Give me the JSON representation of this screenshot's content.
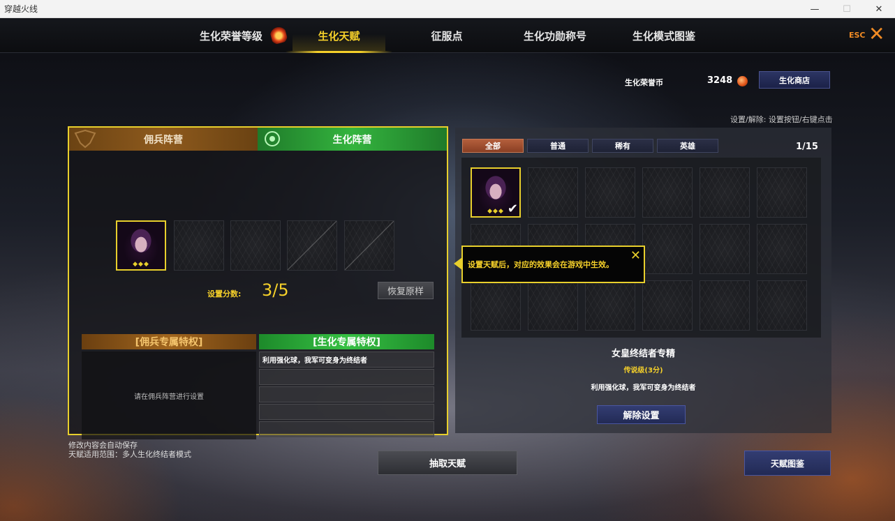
{
  "window": {
    "title": "穿越火线",
    "minimize": "—",
    "maximize": "☐",
    "close": "✕"
  },
  "nav": {
    "tabs": [
      {
        "label": "生化荣誉等级"
      },
      {
        "label": "生化天赋",
        "active": true
      },
      {
        "label": "征服点"
      },
      {
        "label": "生化功勋称号"
      },
      {
        "label": "生化模式图鉴"
      }
    ],
    "esc_label": "ESC",
    "esc_icon": "✕"
  },
  "currency": {
    "label": "生化荣誉币",
    "value": "3248",
    "shop_button": "生化商店"
  },
  "hint_top": "设置/解除: 设置按钮/右键点击",
  "left_panel": {
    "camp_merc": "佣兵阵营",
    "camp_bio": "生化阵营",
    "slot_stars": "◆◆◆",
    "score_label": "设置分数:",
    "score_value": "3/5",
    "reset_button": "恢复原样",
    "merc_privilege_title": "[佣兵专属特权]",
    "bio_privilege_title": "[生化专属特权]",
    "merc_privilege_empty": "请在佣兵阵营进行设置",
    "bio_privileges": [
      "利用强化球，我军可变身为终结者",
      "",
      "",
      "",
      ""
    ]
  },
  "right_panel": {
    "tabs": [
      {
        "label": "全部",
        "active": true
      },
      {
        "label": "普通"
      },
      {
        "label": "稀有"
      },
      {
        "label": "英雄"
      }
    ],
    "page_count": "1/15",
    "card_title": "女皇终结者专精",
    "card_grade": "传说级(3分)",
    "card_desc": "利用强化球，我军可变身为终结者",
    "remove_button": "解除设置"
  },
  "tooltip": {
    "text": "设置天赋后，对应的效果会在游戏中生效。",
    "close_icon": "✕"
  },
  "footer": {
    "note_line1": "修改内容会自动保存",
    "note_line2": "天赋适用范围：多人生化终结者模式",
    "draw_button": "抽取天赋",
    "atlas_button": "天赋图鉴"
  },
  "colors": {
    "accent_yellow": "#e8cf2c",
    "merc_brown": "#8e5a1d",
    "bio_green": "#34b43e",
    "esc_orange": "#f08b24",
    "button_navy": "#2c3563"
  }
}
